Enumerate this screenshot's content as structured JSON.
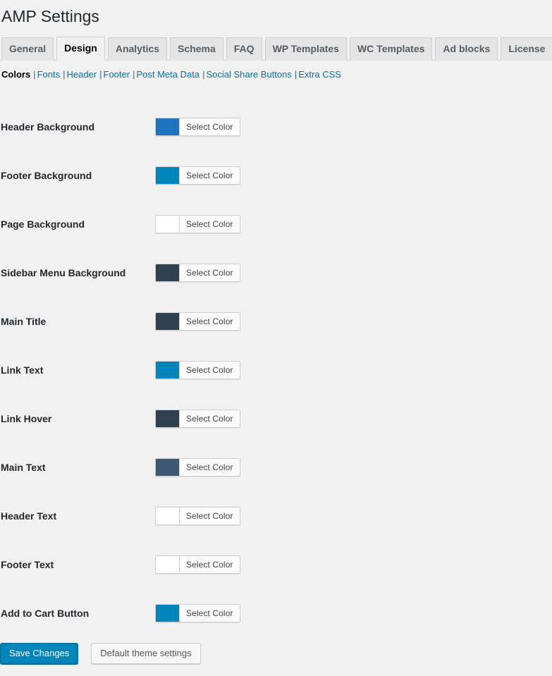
{
  "page": {
    "title": "AMP Settings"
  },
  "tabs": [
    {
      "label": "General",
      "active": false
    },
    {
      "label": "Design",
      "active": true
    },
    {
      "label": "Analytics",
      "active": false
    },
    {
      "label": "Schema",
      "active": false
    },
    {
      "label": "FAQ",
      "active": false
    },
    {
      "label": "WP Templates",
      "active": false
    },
    {
      "label": "WC Templates",
      "active": false
    },
    {
      "label": "Ad blocks",
      "active": false
    },
    {
      "label": "License",
      "active": false
    }
  ],
  "subnav": {
    "separator": "|",
    "items": [
      {
        "label": "Colors",
        "current": true
      },
      {
        "label": "Fonts",
        "current": false
      },
      {
        "label": "Header",
        "current": false
      },
      {
        "label": "Footer",
        "current": false
      },
      {
        "label": "Post Meta Data",
        "current": false
      },
      {
        "label": "Social Share Buttons",
        "current": false
      },
      {
        "label": "Extra CSS",
        "current": false
      }
    ]
  },
  "color_settings": {
    "button_label": "Select Color",
    "rows": [
      {
        "label": "Header Background",
        "color": "#1e73be"
      },
      {
        "label": "Footer Background",
        "color": "#0085ba"
      },
      {
        "label": "Page Background",
        "color": "#ffffff"
      },
      {
        "label": "Sidebar Menu Background",
        "color": "#2f4050"
      },
      {
        "label": "Main Title",
        "color": "#2f4050"
      },
      {
        "label": "Link Text",
        "color": "#0085ba"
      },
      {
        "label": "Link Hover",
        "color": "#2f4050"
      },
      {
        "label": "Main Text",
        "color": "#3f5872"
      },
      {
        "label": "Header Text",
        "color": "#ffffff"
      },
      {
        "label": "Footer Text",
        "color": "#ffffff"
      },
      {
        "label": "Add to Cart Button",
        "color": "#0085ba"
      }
    ]
  },
  "footer_actions": {
    "save_label": "Save Changes",
    "reset_label": "Default theme settings"
  },
  "theme": {
    "page_background": "#f1f1f1",
    "link_color": "#0073aa",
    "primary_button": "#0085ba",
    "text_color": "#23282d"
  }
}
